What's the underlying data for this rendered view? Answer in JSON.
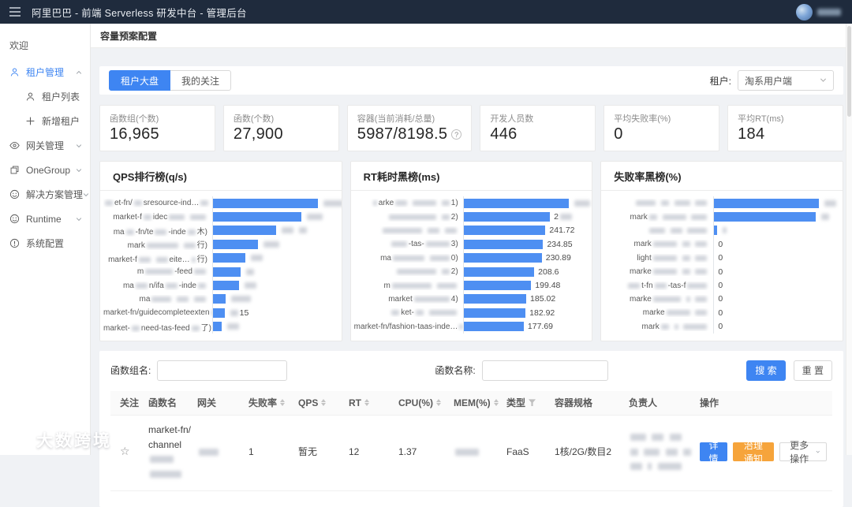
{
  "topbar": {
    "title": "阿里巴巴 - 前端 Serverless 研发中台 - 管理后台"
  },
  "page": {
    "title": "容量预案配置"
  },
  "sidebar": {
    "items": [
      {
        "id": "welcome",
        "label": "欢迎",
        "plain": true
      },
      {
        "id": "tenant-management",
        "label": "租户管理",
        "icon": "user",
        "active": true,
        "chevron": "up"
      },
      {
        "id": "tenant-list",
        "label": "租户列表",
        "icon": "user",
        "child": true
      },
      {
        "id": "tenant-add",
        "label": "新增租户",
        "icon": "plus",
        "child": true
      },
      {
        "id": "gateway-management",
        "label": "网关管理",
        "icon": "eye",
        "chevron": "down"
      },
      {
        "id": "onegroup",
        "label": "OneGroup",
        "icon": "copy",
        "chevron": "down"
      },
      {
        "id": "solution-management",
        "label": "解决方案管理",
        "icon": "smile",
        "chevron": "down"
      },
      {
        "id": "runtime",
        "label": "Runtime",
        "icon": "smile",
        "chevron": "down"
      },
      {
        "id": "system-config",
        "label": "系统配置",
        "icon": "info"
      }
    ]
  },
  "tabs": [
    {
      "id": "tenant-dashboard",
      "label": "租户大盘",
      "active": true
    },
    {
      "id": "my-follows",
      "label": "我的关注",
      "active": false
    }
  ],
  "tenant_filter": {
    "label": "租户:",
    "value": "淘系用户端"
  },
  "stats": [
    {
      "label": "函数组(个数)",
      "value": "16,965"
    },
    {
      "label": "函数(个数)",
      "value": "27,900"
    },
    {
      "label": "容器(当前消耗/总量)",
      "value": "5987/8198.5",
      "help_icon": true
    },
    {
      "label": "开发人员数",
      "value": "446"
    },
    {
      "label": "平均失败率(%)",
      "value": "0"
    },
    {
      "label": "平均RT(ms)",
      "value": "184"
    }
  ],
  "chart_data": [
    {
      "type": "bar",
      "orientation": "horizontal",
      "title": "QPS排行榜(q/s)",
      "value_axis_labels_hidden": true,
      "max": 100,
      "bars": [
        {
          "label": "██et-fn/██sresource-ind…██",
          "value": 100,
          "display": "█████"
        },
        {
          "label": "market-f██idec████ ████",
          "value": 84,
          "display": "████"
        },
        {
          "label": "ma██-fn/te███-inde██木)",
          "value": 60,
          "display": "███ ██"
        },
        {
          "label": "mark████████ ███行)",
          "value": 43,
          "display": "████"
        },
        {
          "label": "market-f███ ███eite…█行)",
          "value": 31,
          "display": "███"
        },
        {
          "label": "m███████-feed███",
          "value": 26,
          "display": "██"
        },
        {
          "label": "ma███n/ifa███-inde██",
          "value": 25,
          "display": "███"
        },
        {
          "label": "ma█████ ███ ███",
          "value": 12,
          "display": "█████"
        },
        {
          "label": "market-fn/guidecompleteexten███",
          "value": 11,
          "display": "██15"
        },
        {
          "label": "market-██need-tas-feed██了)",
          "value": 8,
          "display": "███"
        }
      ]
    },
    {
      "type": "bar",
      "orientation": "horizontal",
      "title": "RT耗时黑榜(ms)",
      "max": 310,
      "bars": [
        {
          "label": "█arke███ ██████ ██1)",
          "value": 310,
          "display": "████"
        },
        {
          "label": "████████████ ██2)",
          "value": 255,
          "display": "2███"
        },
        {
          "label": "██████████ ███ ███",
          "value": 241.72,
          "display": "241.72"
        },
        {
          "label": "████-tas-██████3)",
          "value": 234.85,
          "display": "234.85"
        },
        {
          "label": "ma████████ █████0)",
          "value": 230.89,
          "display": "230.89"
        },
        {
          "label": "██████████ ██2)",
          "value": 208.6,
          "display": "208.6"
        },
        {
          "label": "m██████████ █████",
          "value": 199.48,
          "display": "199.48"
        },
        {
          "label": "market█████████4)",
          "value": 185.02,
          "display": "185.02"
        },
        {
          "label": "██ket-██ ███████",
          "value": 182.92,
          "display": "182.92"
        },
        {
          "label": "market-fn/fashion-taas-inde…█5)",
          "value": 177.69,
          "display": "177.69"
        }
      ]
    },
    {
      "type": "bar",
      "orientation": "horizontal",
      "title": "失败率黑榜(%)",
      "max": 100,
      "bars": [
        {
          "label": "█████ ██ ████ ███",
          "value": 100,
          "display": "███"
        },
        {
          "label": "mark██ ██████ ████",
          "value": 97,
          "display": "██"
        },
        {
          "label": "████ ███ █████",
          "value": 3,
          "display": "█"
        },
        {
          "label": "mark██████ ██ ███",
          "value": 0,
          "display": "0"
        },
        {
          "label": "light██████ ██ ███",
          "value": 0,
          "display": "0"
        },
        {
          "label": "marke██████ ██ ███",
          "value": 0,
          "display": "0"
        },
        {
          "label": "███t-fn███-tas-f█████",
          "value": 0,
          "display": "0"
        },
        {
          "label": "marke███████ █ ███",
          "value": 0,
          "display": "0"
        },
        {
          "label": "marke██████ ███",
          "value": 0,
          "display": "0"
        },
        {
          "label": "mark██ █ ██████",
          "value": 0,
          "display": "0"
        }
      ]
    }
  ],
  "search": {
    "group_label": "函数组名:",
    "name_label": "函数名称:",
    "search_btn": "搜 索",
    "reset_btn": "重 置"
  },
  "table": {
    "columns": [
      {
        "label": "关注"
      },
      {
        "label": "函数名"
      },
      {
        "label": "网关"
      },
      {
        "label": "失败率",
        "sorter": true
      },
      {
        "label": "QPS",
        "sorter": true
      },
      {
        "label": "RT",
        "sorter": true
      },
      {
        "label": "CPU(%)",
        "sorter": true
      },
      {
        "label": "MEM(%)",
        "sorter": true
      },
      {
        "label": "类型",
        "filter": true
      },
      {
        "label": "容器规格"
      },
      {
        "label": "负责人"
      },
      {
        "label": "操作"
      }
    ],
    "rows": [
      {
        "star": "☆",
        "func_name": "market-fn/channel██████ ████████",
        "gateway": "█████",
        "fail_rate": "1",
        "qps": "暂无",
        "rt": "12",
        "cpu": "1.37",
        "mem": "██████",
        "type": "FaaS",
        "container_spec": "1核/2G/数目2",
        "owner": "████ ███ ███ ██ ████ ███ ██ ███ █ ██████",
        "actions": [
          {
            "label": "详情",
            "variant": "primary"
          },
          {
            "label": "治理通知",
            "variant": "warning"
          },
          {
            "label": "更多操作",
            "variant": "default",
            "chevron": true
          }
        ]
      }
    ]
  },
  "colors": {
    "navbar_bg": "#1f2b3d",
    "primary_blue": "#3e85f2",
    "bar_blue": "#4e8ff2",
    "warning_orange": "#f6a43b",
    "page_bg": "#f0f2f5"
  },
  "watermark": "大数跨境"
}
